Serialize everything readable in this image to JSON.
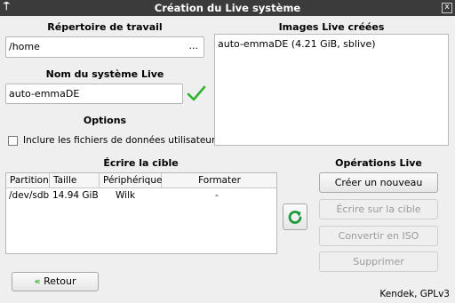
{
  "window": {
    "title": "Création du Live système",
    "menu_icon": "pin-icon",
    "close_label": "x"
  },
  "left": {
    "workdir_label": "Répertoire de travail",
    "workdir_value": "/home",
    "browse_label": "...",
    "name_label": "Nom du système Live",
    "name_value": "auto-emmaDE",
    "options_label": "Options",
    "include_user_data_label": "Inclure les fichiers de données utilisateur"
  },
  "right": {
    "images_label": "Images Live créées",
    "images": [
      "auto-emmaDE (4.21 GiB, sblive)"
    ]
  },
  "target": {
    "label": "Écrire la cible",
    "columns": [
      "Partition",
      "Taille",
      "Périphérique",
      "Formater"
    ],
    "rows": [
      {
        "partition": "/dev/sdb",
        "size": "14.94 GiB",
        "device": "Wilk",
        "format": "-"
      }
    ]
  },
  "operations": {
    "label": "Opérations Live",
    "create": "Créer un nouveau",
    "write": "Écrire sur la cible",
    "convert": "Convertir en ISO",
    "delete": "Supprimer"
  },
  "footer": {
    "back": "Retour",
    "credits": "Kendek, GPLv3"
  },
  "colors": {
    "check": "#2db32d",
    "refresh": "#1a9a3a",
    "back_arrow": "#2fae2f"
  }
}
